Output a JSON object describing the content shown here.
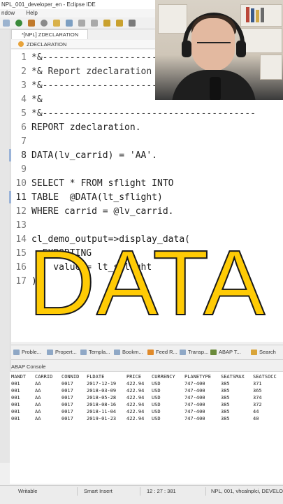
{
  "window": {
    "title": "NPL_001_developer_en - Eclipse IDE"
  },
  "menu": {
    "items": [
      "ndow",
      "Help"
    ]
  },
  "editor": {
    "tab_label": "*[NPL] ZDECLARATION",
    "breadcrumb": "ZDECLARATION",
    "lines": [
      {
        "n": "1",
        "text": "*&---------------------------------------"
      },
      {
        "n": "2",
        "text": "*& Report zdeclaration"
      },
      {
        "n": "3",
        "text": "*&---------------------------------------"
      },
      {
        "n": "4",
        "text": "*&"
      },
      {
        "n": "5",
        "text": "*&---------------------------------------"
      },
      {
        "n": "6",
        "text": "REPORT zdeclaration."
      },
      {
        "n": "7",
        "text": ""
      },
      {
        "n": "8",
        "text": "DATA(lv_carrid) = 'AA'."
      },
      {
        "n": "9",
        "text": ""
      },
      {
        "n": "10",
        "text": "SELECT * FROM sflight INTO"
      },
      {
        "n": "11",
        "text": "TABLE  @DATA(lt_sflight)"
      },
      {
        "n": "12",
        "text": "WHERE carrid = @lv_carrid."
      },
      {
        "n": "13",
        "text": ""
      },
      {
        "n": "14",
        "text": "cl_demo_output=>display_data("
      },
      {
        "n": "15",
        "text": "  EXPORTING"
      },
      {
        "n": "16",
        "text": "    value = lt_sflight"
      },
      {
        "n": "17",
        "text": ")."
      }
    ]
  },
  "overlay": {
    "word": "DATA",
    "color": "#ffcb05"
  },
  "views": {
    "tabs": [
      "Proble...",
      "Propert...",
      "Templa...",
      "Bookm...",
      "Feed R...",
      "Transp...",
      "ABAP T...",
      "Search"
    ]
  },
  "console": {
    "title": "ABAP Console",
    "headers": [
      "MANDT",
      "CARRID",
      "CONNID",
      "FLDATE",
      "PRICE",
      "CURRENCY",
      "PLANETYPE",
      "SEATSMAX",
      "SEATSOCC"
    ],
    "rows": [
      [
        "001",
        "AA",
        "0017",
        "2017-12-19",
        "422.94",
        "USD",
        "747-400",
        "385",
        "371"
      ],
      [
        "001",
        "AA",
        "0017",
        "2018-03-09",
        "422.94",
        "USD",
        "747-400",
        "385",
        "365"
      ],
      [
        "001",
        "AA",
        "0017",
        "2018-05-28",
        "422.94",
        "USD",
        "747-400",
        "385",
        "374"
      ],
      [
        "001",
        "AA",
        "0017",
        "2018-08-16",
        "422.94",
        "USD",
        "747-400",
        "385",
        "372"
      ],
      [
        "001",
        "AA",
        "0017",
        "2018-11-04",
        "422.94",
        "USD",
        "747-400",
        "385",
        "44"
      ],
      [
        "001",
        "AA",
        "0017",
        "2019-01-23",
        "422.94",
        "USD",
        "747-400",
        "385",
        "40"
      ]
    ]
  },
  "status": {
    "mode": "Writable",
    "insert": "Smart Insert",
    "position": "12 : 27 : 381",
    "system": "NPL, 001, vhcalnplci, DEVELOPE"
  }
}
